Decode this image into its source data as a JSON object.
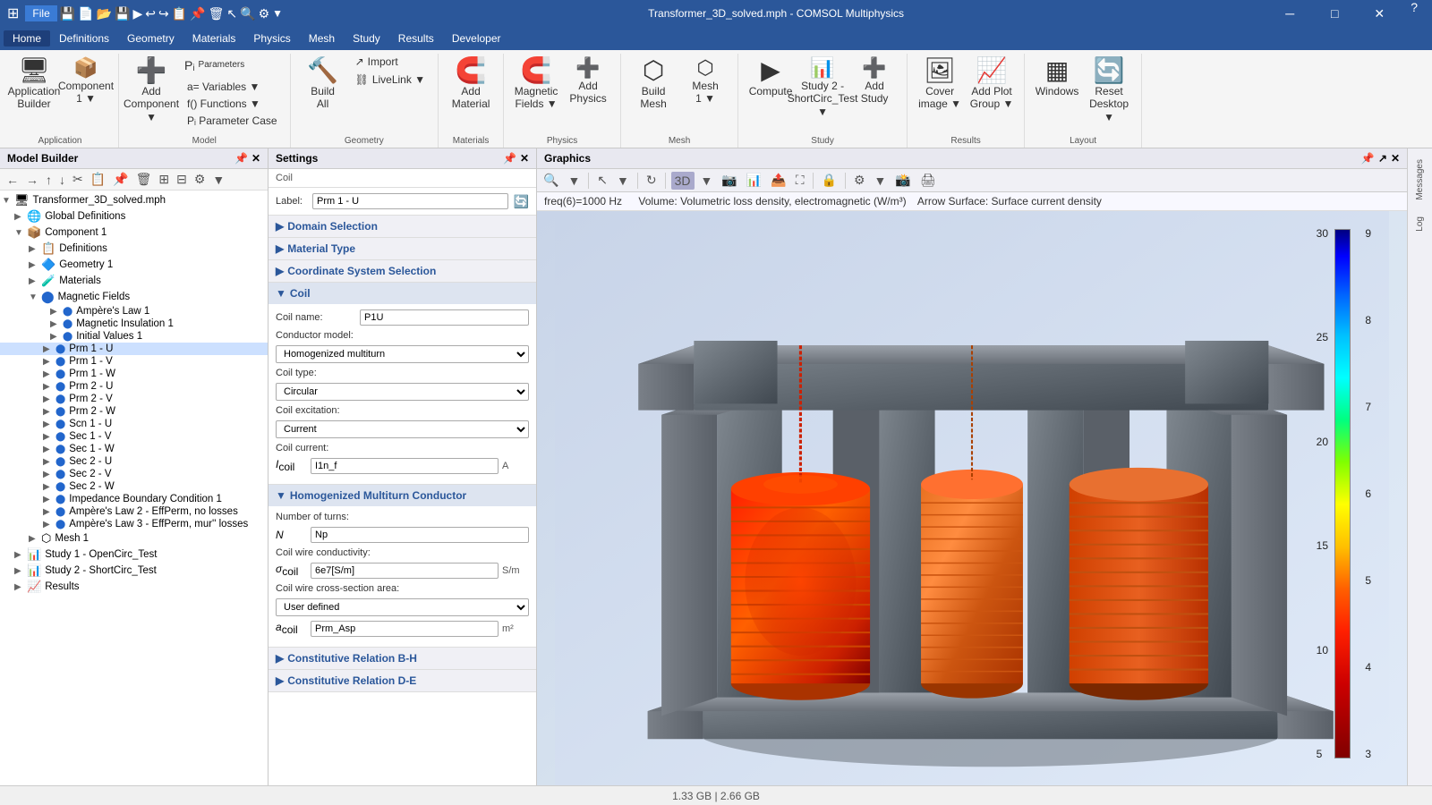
{
  "titlebar": {
    "title": "Transformer_3D_solved.mph - COMSOL Multiphysics",
    "help": "?"
  },
  "menubar": {
    "items": [
      "File",
      "Home",
      "Definitions",
      "Geometry",
      "Materials",
      "Physics",
      "Mesh",
      "Study",
      "Results",
      "Developer"
    ]
  },
  "ribbon": {
    "groups": [
      {
        "label": "Application",
        "buttons": [
          {
            "label": "Application\nBuilder",
            "icon": "🖥"
          },
          {
            "label": "Component\n1 ▼",
            "icon": "📦"
          }
        ]
      },
      {
        "label": "Model",
        "buttons": [
          {
            "label": "Add\nComponent ▼",
            "icon": "➕"
          },
          {
            "label": "Parameters",
            "icon": "Pᵢ"
          }
        ],
        "small_buttons": [
          {
            "label": "a= Variables ▼"
          },
          {
            "label": "f() Functions ▼"
          },
          {
            "label": "Pᵢ Parameter Case"
          }
        ]
      },
      {
        "label": "Geometry",
        "buttons": [
          {
            "label": "Build\nAll",
            "icon": "🔨"
          },
          {
            "label": "↗ Import"
          },
          {
            "label": "⛓ LiveLink ▼"
          }
        ]
      },
      {
        "label": "Materials",
        "buttons": [
          {
            "label": "Add\nMaterial",
            "icon": "🧲"
          }
        ]
      },
      {
        "label": "Physics",
        "buttons": [
          {
            "label": "Magnetic\nFields ▼",
            "icon": "🧲"
          },
          {
            "label": "Add\nPhysics",
            "icon": "➕"
          }
        ]
      },
      {
        "label": "Mesh",
        "buttons": [
          {
            "label": "Build\nMesh",
            "icon": "⬡"
          },
          {
            "label": "Mesh\n1 ▼",
            "icon": "⬡"
          }
        ]
      },
      {
        "label": "Study",
        "buttons": [
          {
            "label": "Compute",
            "icon": "▶"
          },
          {
            "label": "Study 2 -\nShortCirc_Test ▼",
            "icon": "📊"
          },
          {
            "label": "Add\nStudy",
            "icon": "➕"
          }
        ]
      },
      {
        "label": "Results",
        "buttons": [
          {
            "label": "Cover\nimage ▼",
            "icon": "🖼"
          },
          {
            "label": "Add Plot\nGroup ▼",
            "icon": "📈"
          }
        ]
      },
      {
        "label": "Layout",
        "buttons": [
          {
            "label": "Windows",
            "icon": "▦"
          },
          {
            "label": "Reset\nDesktop ▼",
            "icon": "🔄"
          }
        ]
      }
    ]
  },
  "model_builder": {
    "header": "Model Builder",
    "tree": [
      {
        "id": "root",
        "label": "Transformer_3D_solved.mph",
        "level": 0,
        "expanded": true,
        "icon": "📁"
      },
      {
        "id": "global-defs",
        "label": "Global Definitions",
        "level": 1,
        "expanded": false,
        "icon": "🌐"
      },
      {
        "id": "comp1",
        "label": "Component 1",
        "level": 1,
        "expanded": true,
        "icon": "📦"
      },
      {
        "id": "defs",
        "label": "Definitions",
        "level": 2,
        "expanded": false,
        "icon": "📋"
      },
      {
        "id": "geom1",
        "label": "Geometry 1",
        "level": 2,
        "expanded": false,
        "icon": "⬡"
      },
      {
        "id": "materials",
        "label": "Materials",
        "level": 2,
        "expanded": false,
        "icon": "🧪"
      },
      {
        "id": "mf",
        "label": "Magnetic Fields",
        "level": 2,
        "expanded": true,
        "icon": "🔵"
      },
      {
        "id": "amperes",
        "label": "Ampère's Law 1",
        "level": 3,
        "expanded": false,
        "icon": "🔵"
      },
      {
        "id": "mag-ins",
        "label": "Magnetic Insulation 1",
        "level": 3,
        "expanded": false,
        "icon": "🔵"
      },
      {
        "id": "init",
        "label": "Initial Values 1",
        "level": 3,
        "expanded": false,
        "icon": "🔵"
      },
      {
        "id": "prm1u",
        "label": "Prm 1 - U",
        "level": 3,
        "expanded": false,
        "icon": "🔵",
        "selected": true
      },
      {
        "id": "prm1v",
        "label": "Prm 1 - V",
        "level": 3,
        "expanded": false,
        "icon": "🔵"
      },
      {
        "id": "prm1w",
        "label": "Prm 1 - W",
        "level": 3,
        "expanded": false,
        "icon": "🔵"
      },
      {
        "id": "prm2u",
        "label": "Prm 2 - U",
        "level": 3,
        "expanded": false,
        "icon": "🔵"
      },
      {
        "id": "prm2v",
        "label": "Prm 2 - V",
        "level": 3,
        "expanded": false,
        "icon": "🔵"
      },
      {
        "id": "prm2w",
        "label": "Prm 2 - W",
        "level": 3,
        "expanded": false,
        "icon": "🔵"
      },
      {
        "id": "scn1u",
        "label": "Scn 1 - U",
        "level": 3,
        "expanded": false,
        "icon": "🔵"
      },
      {
        "id": "sec1v",
        "label": "Sec 1 - V",
        "level": 3,
        "expanded": false,
        "icon": "🔵"
      },
      {
        "id": "sec1w",
        "label": "Sec 1 - W",
        "level": 3,
        "expanded": false,
        "icon": "🔵"
      },
      {
        "id": "sec2u",
        "label": "Sec 2 - U",
        "level": 3,
        "expanded": false,
        "icon": "🔵"
      },
      {
        "id": "sec2v",
        "label": "Sec 2 - V",
        "level": 3,
        "expanded": false,
        "icon": "🔵"
      },
      {
        "id": "sec2w",
        "label": "Sec 2 - W",
        "level": 3,
        "expanded": false,
        "icon": "🔵"
      },
      {
        "id": "imp-bc",
        "label": "Impedance Boundary Condition 1",
        "level": 3,
        "expanded": false,
        "icon": "🔵"
      },
      {
        "id": "amperes2",
        "label": "Ampère's Law 2 - EffPerm, no losses",
        "level": 3,
        "expanded": false,
        "icon": "🔵"
      },
      {
        "id": "amperes3",
        "label": "Ampère's Law 3 - EffPerm, mur'' losses",
        "level": 3,
        "expanded": false,
        "icon": "🔵"
      },
      {
        "id": "mesh1",
        "label": "Mesh 1",
        "level": 2,
        "expanded": false,
        "icon": "⬡"
      },
      {
        "id": "study1",
        "label": "Study 1 - OpenCirc_Test",
        "level": 1,
        "expanded": false,
        "icon": "📊"
      },
      {
        "id": "study2",
        "label": "Study 2 - ShortCirc_Test",
        "level": 1,
        "expanded": false,
        "icon": "📊"
      },
      {
        "id": "results",
        "label": "Results",
        "level": 1,
        "expanded": false,
        "icon": "📈"
      }
    ]
  },
  "settings": {
    "header": "Settings",
    "subtitle": "Coil",
    "label_field": {
      "label": "Label:",
      "value": "Prm 1 - U"
    },
    "sections": [
      {
        "title": "Domain Selection",
        "expanded": false
      },
      {
        "title": "Material Type",
        "expanded": false
      },
      {
        "title": "Coordinate System Selection",
        "expanded": false
      },
      {
        "title": "Coil",
        "expanded": true,
        "fields": [
          {
            "key": "coil_name_label",
            "label": "Coil name:",
            "type": "text",
            "value": "P1U"
          },
          {
            "key": "conductor_model_label",
            "label": "Conductor model:",
            "type": "select",
            "value": "Homogenized multiturn"
          },
          {
            "key": "coil_type_label",
            "label": "Coil type:",
            "type": "select",
            "value": "Circular"
          },
          {
            "key": "coil_excitation_label",
            "label": "Coil excitation:",
            "type": "select",
            "value": "Current"
          },
          {
            "key": "coil_current_label",
            "label": "Icoil",
            "type": "text",
            "value": "I1n_f",
            "unit": "A"
          }
        ]
      },
      {
        "title": "Homogenized Multiturn Conductor",
        "expanded": true,
        "fields": [
          {
            "key": "num_turns_label",
            "label": "Number of turns:",
            "type": "header"
          },
          {
            "key": "N_label",
            "label": "N",
            "type": "text",
            "value": "Np"
          },
          {
            "key": "wire_cond_label",
            "label": "Coil wire conductivity:",
            "type": "header"
          },
          {
            "key": "sigma_label",
            "label": "σcoil",
            "type": "text",
            "value": "6e7[S/m]",
            "unit": "S/m"
          },
          {
            "key": "cross_section_label",
            "label": "Coil wire cross-section area:",
            "type": "header"
          },
          {
            "key": "area_type_label",
            "label": "",
            "type": "select",
            "value": "User defined"
          },
          {
            "key": "a_coil_label",
            "label": "acoil",
            "type": "text",
            "value": "Prm_Asp",
            "unit": "m²"
          }
        ]
      },
      {
        "title": "Constitutive Relation B-H",
        "expanded": false
      },
      {
        "title": "Constitutive Relation D-E",
        "expanded": false
      }
    ]
  },
  "graphics": {
    "header": "Graphics",
    "info_freq": "freq(6)=1000 Hz",
    "info_volume": "Volume: Volumetric loss density, electromagnetic (W/m³)",
    "info_arrow": "Arrow Surface: Surface current density",
    "colorbar": {
      "max": "30",
      "ticks": [
        "30",
        "25",
        "20",
        "15",
        "10",
        "5"
      ],
      "right_ticks": [
        "9",
        "8",
        "7",
        "6",
        "5",
        "4",
        "3"
      ]
    }
  },
  "statusbar": {
    "memory": "1.33 GB | 2.66 GB"
  },
  "right_panel": {
    "buttons": [
      "Messages",
      "Log"
    ]
  }
}
